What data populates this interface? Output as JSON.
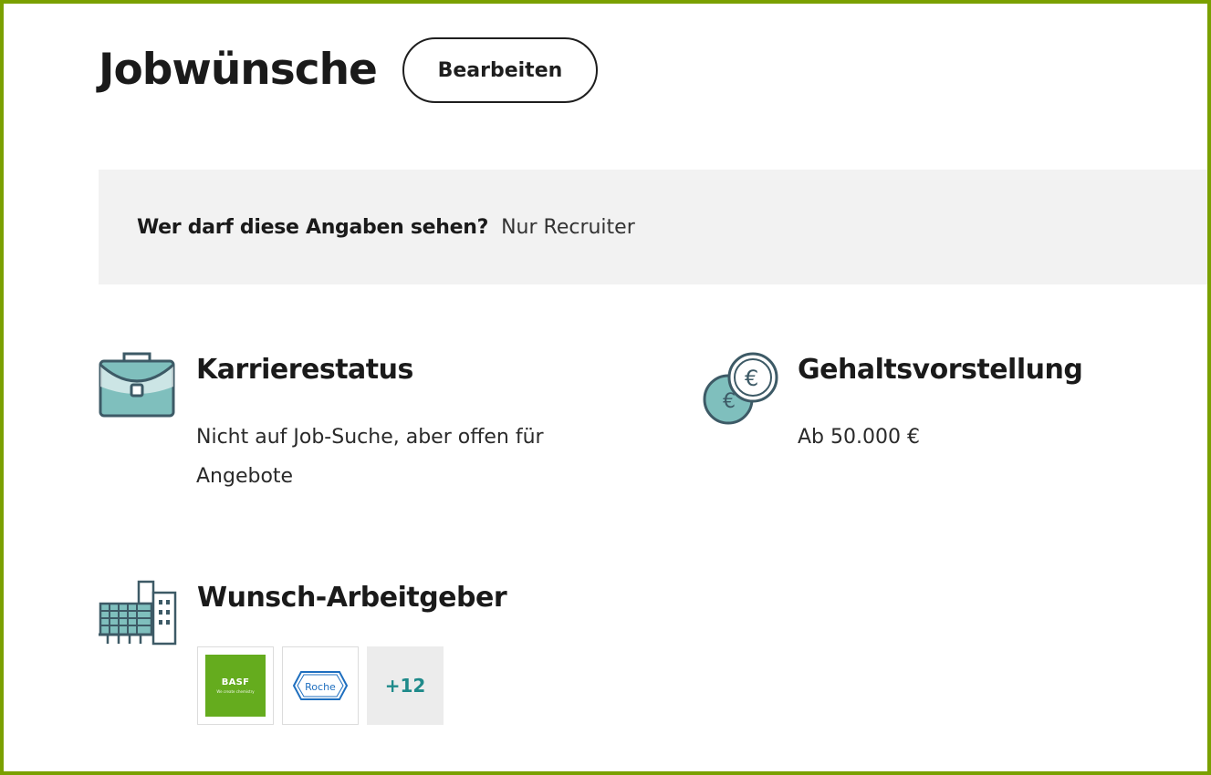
{
  "header": {
    "title": "Jobwünsche",
    "edit_label": "Bearbeiten"
  },
  "visibility": {
    "question": "Wer darf diese Angaben sehen?",
    "answer": "Nur Recruiter"
  },
  "career": {
    "title": "Karrierestatus",
    "value": "Nicht auf Job-Suche, aber offen für Angebote",
    "icon": "briefcase-icon"
  },
  "salary": {
    "title": "Gehaltsvorstellung",
    "value": "Ab 50.000 €",
    "icon": "euro-coins-icon"
  },
  "employers": {
    "title": "Wunsch-Arbeitgeber",
    "icon": "office-buildings-icon",
    "logos": [
      {
        "name": "BASF",
        "text": "BASF",
        "tagline": "We create chemistry",
        "color": "#65ac1e"
      },
      {
        "name": "Roche",
        "text": "Roche",
        "color": "#1f6fbf"
      }
    ],
    "more_count": "+12"
  },
  "colors": {
    "frame_border": "#7aa000",
    "icon_teal": "#7fbfbd",
    "icon_stroke": "#3d5a66",
    "more_text": "#1f8a8a",
    "panel_bg": "#f2f2f2"
  }
}
